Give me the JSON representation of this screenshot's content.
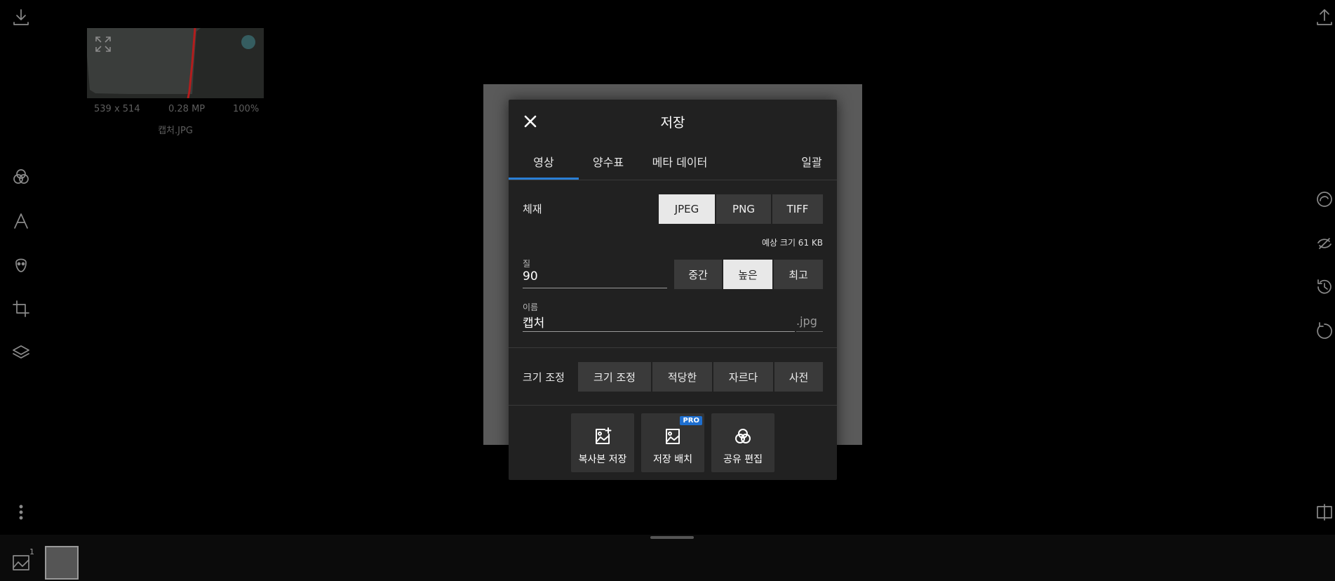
{
  "app": {
    "left_toolbar": [
      "download-icon",
      "filters-icon",
      "text-icon",
      "face-icon",
      "crop-icon",
      "layers-icon",
      "more-icon"
    ],
    "right_toolbar": [
      "upload-icon",
      "auto-enhance-icon",
      "no-edit-icon",
      "history-icon",
      "undo-icon",
      "compare-icon"
    ]
  },
  "histogram": {
    "dimensions": "539 x 514",
    "megapixels": "0.28 MP",
    "zoom": "100%",
    "filename": "캡처.JPG"
  },
  "dialog": {
    "title": "저장",
    "tabs": [
      "영상",
      "양수표",
      "메타 데이터",
      "일괄"
    ],
    "active_tab": "영상",
    "format": {
      "label": "체재",
      "options": [
        "JPEG",
        "PNG",
        "TIFF"
      ],
      "selected": "JPEG"
    },
    "estimated_size": "예상 크기 61 KB",
    "quality": {
      "label": "질",
      "value": "90",
      "presets": [
        "중간",
        "높은",
        "최고"
      ],
      "selected": "높은"
    },
    "name": {
      "label": "이름",
      "value": "캡처",
      "extension": ".jpg"
    },
    "resize": {
      "label": "크기 조정",
      "options": [
        "크기 조정",
        "적당한",
        "자르다",
        "사전"
      ]
    },
    "actions": [
      {
        "label": "복사본 저장",
        "icon": "save-copy-icon"
      },
      {
        "label": "저장 배치",
        "icon": "batch-save-icon",
        "badge": "PRO"
      },
      {
        "label": "공유 편집",
        "icon": "share-edit-icon"
      }
    ]
  },
  "bottom_bar": {
    "image_count": "1"
  },
  "colors": {
    "accent": "#2a7fd6",
    "dialog_bg": "#212121",
    "pro_badge": "#1e6fd0"
  }
}
